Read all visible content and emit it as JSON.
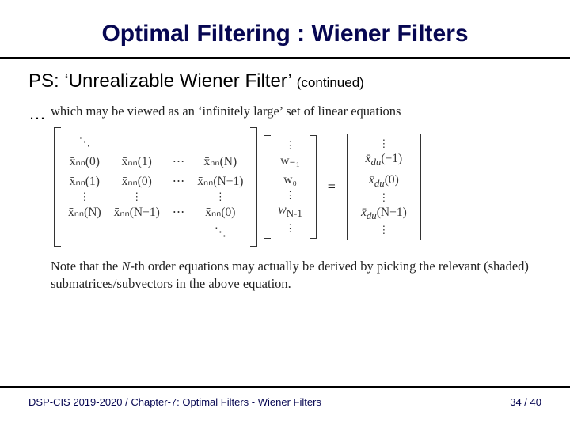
{
  "title": "Optimal Filtering : Wiener Filters",
  "heading": "PS: ‘Unrealizable Wiener Filter’",
  "heading_cont": "(continued)",
  "body": {
    "ellipsis": "…",
    "fig_text_lead": "which may be viewed as an ‘infinitely large’ set of linear equations",
    "fig_note_1": "Note that the ",
    "fig_note_N": "N",
    "fig_note_2": "-th order equations may actually be derived by picking the relevant (shaded) submatrices/subvectors in the above equation.",
    "A": {
      "r0": {
        "c0": "⋱",
        "c1": "",
        "c2": "",
        "c3": ""
      },
      "r1": {
        "c0": "x̄ₙₙ(0)",
        "c1": "x̄ₙₙ(1)",
        "c2": "⋯",
        "c3": "x̄ₙₙ(N)"
      },
      "r2": {
        "c0": "x̄ₙₙ(1)",
        "c1": "x̄ₙₙ(0)",
        "c2": "⋯",
        "c3": "x̄ₙₙ(N−1)"
      },
      "r3": {
        "c0": "⋮",
        "c1": "⋮",
        "c2": "",
        "c3": "⋮"
      },
      "r4": {
        "c0": "x̄ₙₙ(N)",
        "c1": "x̄ₙₙ(N−1)",
        "c2": "⋯",
        "c3": "x̄ₙₙ(0)"
      },
      "r5": {
        "c0": "",
        "c1": "",
        "c2": "",
        "c3": "⋱"
      }
    },
    "w": {
      "r0": "⋮",
      "r1": "w₋₁",
      "r2": "w₀",
      "r3": "⋮",
      "r4": "w_{N-1}",
      "r5": "⋮"
    },
    "eq": "=",
    "b": {
      "r0": "⋮",
      "r1": "x̄_dₙ(−1)",
      "r2": "x̄_dₙ(0)",
      "r3": "⋮",
      "r4": "x̄_dₙ(N−1)",
      "r5": "⋮"
    }
  },
  "footer": {
    "left": "DSP-CIS 2019-2020  /  Chapter-7: Optimal Filters - Wiener Filters",
    "right": "34 / 40"
  }
}
